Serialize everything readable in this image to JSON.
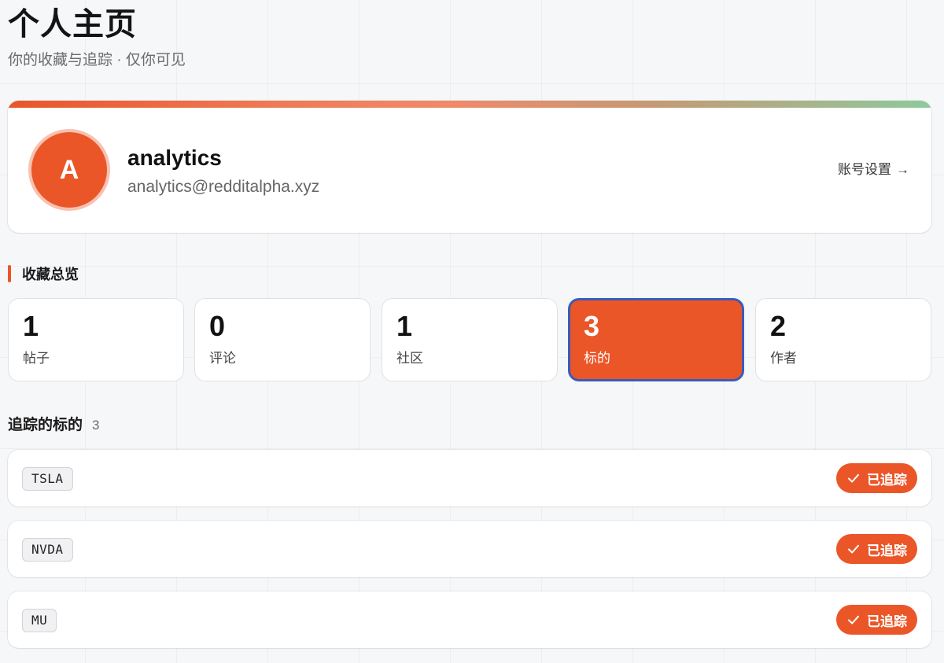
{
  "header": {
    "title": "个人主页",
    "subtitle": "你的收藏与追踪 · 仅你可见"
  },
  "profile": {
    "avatar_initial": "A",
    "username": "analytics",
    "email": "analytics@redditalpha.xyz",
    "settings_label": "账号设置",
    "settings_arrow": "→"
  },
  "overview": {
    "heading": "收藏总览",
    "stats": [
      {
        "value": "1",
        "label": "帖子"
      },
      {
        "value": "0",
        "label": "评论"
      },
      {
        "value": "1",
        "label": "社区"
      },
      {
        "value": "3",
        "label": "标的"
      },
      {
        "value": "2",
        "label": "作者"
      }
    ],
    "active_index": 3
  },
  "tracked": {
    "heading": "追踪的标的",
    "count": "3",
    "items": [
      {
        "ticker": "TSLA",
        "button_label": "已追踪"
      },
      {
        "ticker": "NVDA",
        "button_label": "已追踪"
      },
      {
        "ticker": "MU",
        "button_label": "已追踪"
      }
    ]
  },
  "colors": {
    "accent": "#eb5628",
    "active_border": "#3a5bb8"
  },
  "icons": {
    "check": "check-icon",
    "arrow": "arrow-right-icon"
  }
}
